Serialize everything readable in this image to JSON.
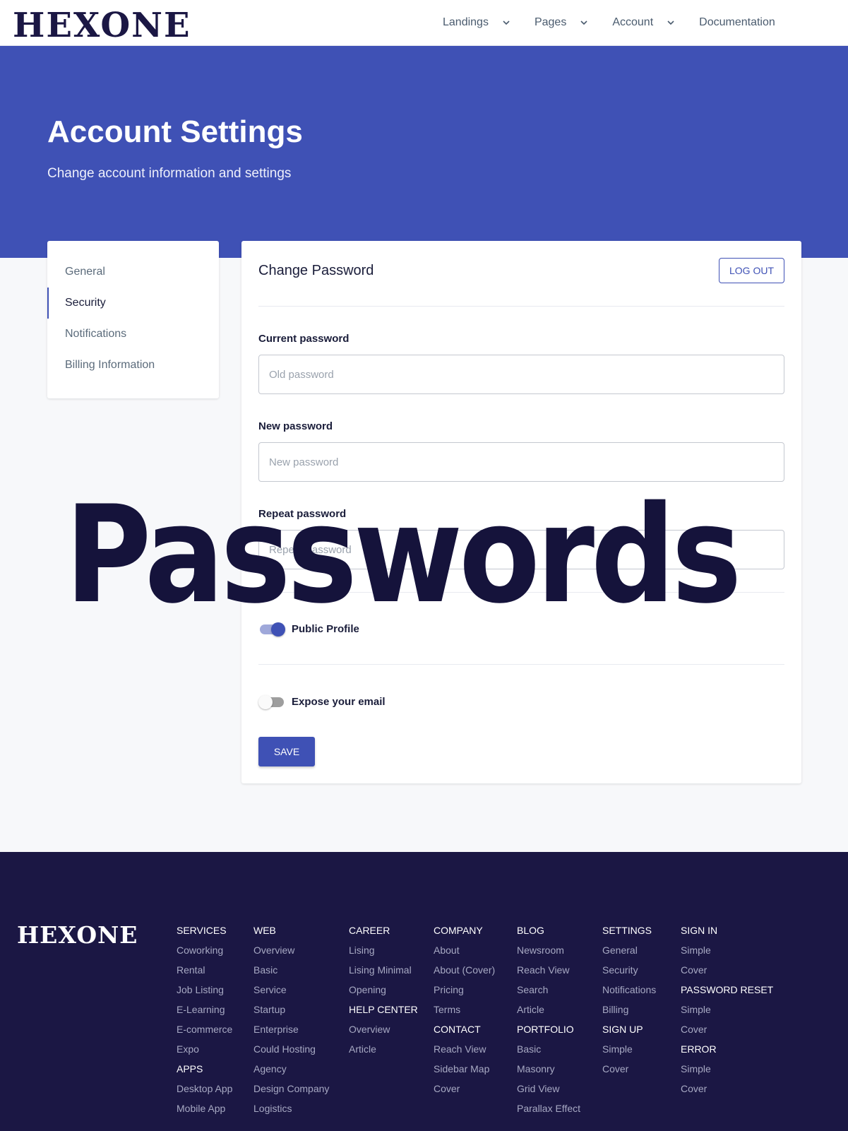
{
  "brand": {
    "logo_text": "HEXONE"
  },
  "nav": {
    "items": [
      {
        "label": "Landings"
      },
      {
        "label": "Pages"
      },
      {
        "label": "Account"
      },
      {
        "label": "Documentation"
      }
    ]
  },
  "hero": {
    "title": "Account Settings",
    "subtitle": "Change account information and settings"
  },
  "sidebar": {
    "items": [
      {
        "label": "General"
      },
      {
        "label": "Security"
      },
      {
        "label": "Notifications"
      },
      {
        "label": "Billing Information"
      }
    ]
  },
  "form": {
    "title": "Change Password",
    "logout_label": "LOG OUT",
    "current_label": "Current password",
    "current_placeholder": "Old password",
    "new_label": "New password",
    "new_placeholder": "New password",
    "repeat_label": "Repeat password",
    "repeat_placeholder": "Repeat password",
    "public_profile_label": "Public Profile",
    "public_profile_on": true,
    "expose_email_label": "Expose your email",
    "expose_email_on": false,
    "save_label": "SAVE"
  },
  "overlay_text": "Passwords",
  "footer": {
    "columns": [
      {
        "items": [
          {
            "t": "SERVICES",
            "h": true
          },
          {
            "t": "Coworking"
          },
          {
            "t": "Rental"
          },
          {
            "t": "Job Listing"
          },
          {
            "t": "E-Learning"
          },
          {
            "t": "E-commerce"
          },
          {
            "t": "Expo"
          },
          {
            "t": "APPS",
            "h": true
          },
          {
            "t": "Desktop App"
          },
          {
            "t": "Mobile App"
          }
        ]
      },
      {
        "items": [
          {
            "t": "WEB",
            "h": true
          },
          {
            "t": "Overview"
          },
          {
            "t": "Basic"
          },
          {
            "t": "Service"
          },
          {
            "t": "Startup"
          },
          {
            "t": "Enterprise"
          },
          {
            "t": "Could Hosting"
          },
          {
            "t": "Agency"
          },
          {
            "t": "Design Company"
          },
          {
            "t": "Logistics"
          }
        ]
      },
      {
        "items": [
          {
            "t": "CAREER",
            "h": true
          },
          {
            "t": "Lising"
          },
          {
            "t": "Lising Minimal"
          },
          {
            "t": "Opening"
          },
          {
            "t": "HELP CENTER",
            "h": true
          },
          {
            "t": "Overview"
          },
          {
            "t": "Article"
          }
        ]
      },
      {
        "items": [
          {
            "t": "COMPANY",
            "h": true
          },
          {
            "t": "About"
          },
          {
            "t": "About (Cover)"
          },
          {
            "t": "Pricing"
          },
          {
            "t": "Terms"
          },
          {
            "t": "CONTACT",
            "h": true
          },
          {
            "t": "Reach View"
          },
          {
            "t": "Sidebar Map"
          },
          {
            "t": "Cover"
          }
        ]
      },
      {
        "items": [
          {
            "t": "BLOG",
            "h": true
          },
          {
            "t": "Newsroom"
          },
          {
            "t": "Reach View"
          },
          {
            "t": "Search"
          },
          {
            "t": "Article"
          },
          {
            "t": "PORTFOLIO",
            "h": true
          },
          {
            "t": "Basic"
          },
          {
            "t": "Masonry"
          },
          {
            "t": "Grid View"
          },
          {
            "t": "Parallax Effect"
          }
        ]
      },
      {
        "items": [
          {
            "t": "SETTINGS",
            "h": true
          },
          {
            "t": "General"
          },
          {
            "t": "Security"
          },
          {
            "t": "Notifications"
          },
          {
            "t": "Billing"
          },
          {
            "t": "SIGN UP",
            "h": true
          },
          {
            "t": "Simple"
          },
          {
            "t": "Cover"
          }
        ]
      },
      {
        "items": [
          {
            "t": "SIGN IN",
            "h": true
          },
          {
            "t": "Simple"
          },
          {
            "t": "Cover"
          },
          {
            "t": "PASSWORD RESET",
            "h": true
          },
          {
            "t": "Simple"
          },
          {
            "t": "Cover"
          },
          {
            "t": "ERROR",
            "h": true
          },
          {
            "t": "Simple"
          },
          {
            "t": "Cover"
          }
        ]
      }
    ]
  },
  "colors": {
    "primary": "#3f51b5",
    "navy": "#1b1744",
    "footer_link": "#a7a9c3"
  }
}
